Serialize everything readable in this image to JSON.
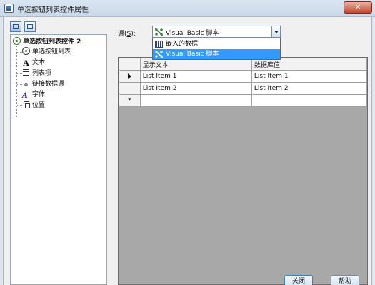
{
  "window": {
    "title": "单选按钮列表控件属性",
    "close_glyph": "✕"
  },
  "tree": {
    "root_label": "单选按钮列表控件 2",
    "items": [
      {
        "label": "单选按钮列表",
        "icon": "radio-button-icon"
      },
      {
        "label": "文本",
        "icon": "text-icon",
        "glyph": "A"
      },
      {
        "label": "列表项",
        "icon": "list-icon"
      },
      {
        "label": "链接数据源",
        "icon": "link-icon",
        "glyph": "⚭"
      },
      {
        "label": "字体",
        "icon": "font-icon",
        "glyph": "A"
      },
      {
        "label": "位置",
        "icon": "position-icon"
      }
    ]
  },
  "source": {
    "label_prefix": "源(",
    "label_hotkey": "S",
    "label_suffix": "):",
    "selected": "Visual Basic 脚本",
    "options": [
      {
        "label": "嵌入的数据",
        "icon": "database-icon",
        "highlighted": false
      },
      {
        "label": "Visual Basic 脚本",
        "icon": "vb-script-icon",
        "highlighted": true
      }
    ]
  },
  "grid": {
    "columns": [
      "显示文本",
      "数据库值"
    ],
    "rows": [
      {
        "marker": "current",
        "display": "List Item 1",
        "value": "List Item 1"
      },
      {
        "marker": "",
        "display": "List Item 2",
        "value": "List Item 2"
      }
    ],
    "new_row_marker": "*"
  },
  "buttons": {
    "close": "关闭",
    "help": "帮助"
  }
}
